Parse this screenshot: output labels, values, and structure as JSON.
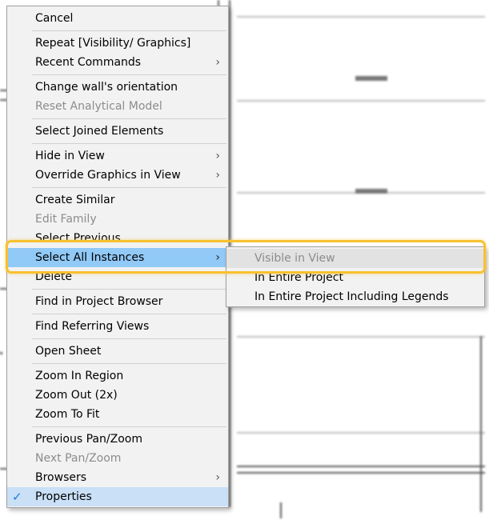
{
  "context_menu": {
    "items": [
      {
        "label": "Cancel",
        "enabled": true
      },
      {
        "separator": true
      },
      {
        "label": "Repeat [Visibility/ Graphics]",
        "enabled": true
      },
      {
        "label": "Recent Commands",
        "enabled": true,
        "submenu": true
      },
      {
        "separator": true
      },
      {
        "label": "Change wall's orientation",
        "enabled": true
      },
      {
        "label": "Reset Analytical Model",
        "enabled": false
      },
      {
        "separator": true
      },
      {
        "label": "Select Joined Elements",
        "enabled": true
      },
      {
        "separator": true
      },
      {
        "label": "Hide in View",
        "enabled": true,
        "submenu": true
      },
      {
        "label": "Override Graphics in View",
        "enabled": true,
        "submenu": true
      },
      {
        "separator": true
      },
      {
        "label": "Create Similar",
        "enabled": true
      },
      {
        "label": "Edit Family",
        "enabled": false
      },
      {
        "label": "Select Previous",
        "enabled": true
      },
      {
        "label": "Select All Instances",
        "enabled": true,
        "submenu": true,
        "highlighted": true
      },
      {
        "label": "Delete",
        "enabled": true
      },
      {
        "separator": true
      },
      {
        "label": "Find in Project Browser",
        "enabled": true
      },
      {
        "separator": true
      },
      {
        "label": "Find Referring Views",
        "enabled": true
      },
      {
        "separator": true
      },
      {
        "label": "Open Sheet",
        "enabled": true
      },
      {
        "separator": true
      },
      {
        "label": "Zoom In Region",
        "enabled": true
      },
      {
        "label": "Zoom Out (2x)",
        "enabled": true
      },
      {
        "label": "Zoom To Fit",
        "enabled": true
      },
      {
        "separator": true
      },
      {
        "label": "Previous Pan/Zoom",
        "enabled": true
      },
      {
        "label": "Next Pan/Zoom",
        "enabled": false
      },
      {
        "label": "Browsers",
        "enabled": true,
        "submenu": true
      },
      {
        "label": "Properties",
        "enabled": true,
        "checked": true
      }
    ]
  },
  "submenu": {
    "parent": "Select All Instances",
    "items": [
      {
        "label": "Visible in View",
        "enabled": false,
        "highlighted": true
      },
      {
        "label": "In Entire Project",
        "enabled": true
      },
      {
        "label": "In Entire Project Including Legends",
        "enabled": true
      }
    ]
  },
  "icons": {
    "submenu_arrow": "chevron-right-icon",
    "check": "checkmark-icon"
  },
  "colors": {
    "menu_bg": "#f2f2f2",
    "highlight": "#91c9f7",
    "callout": "#f7c130",
    "check": "#1f7ad9"
  }
}
